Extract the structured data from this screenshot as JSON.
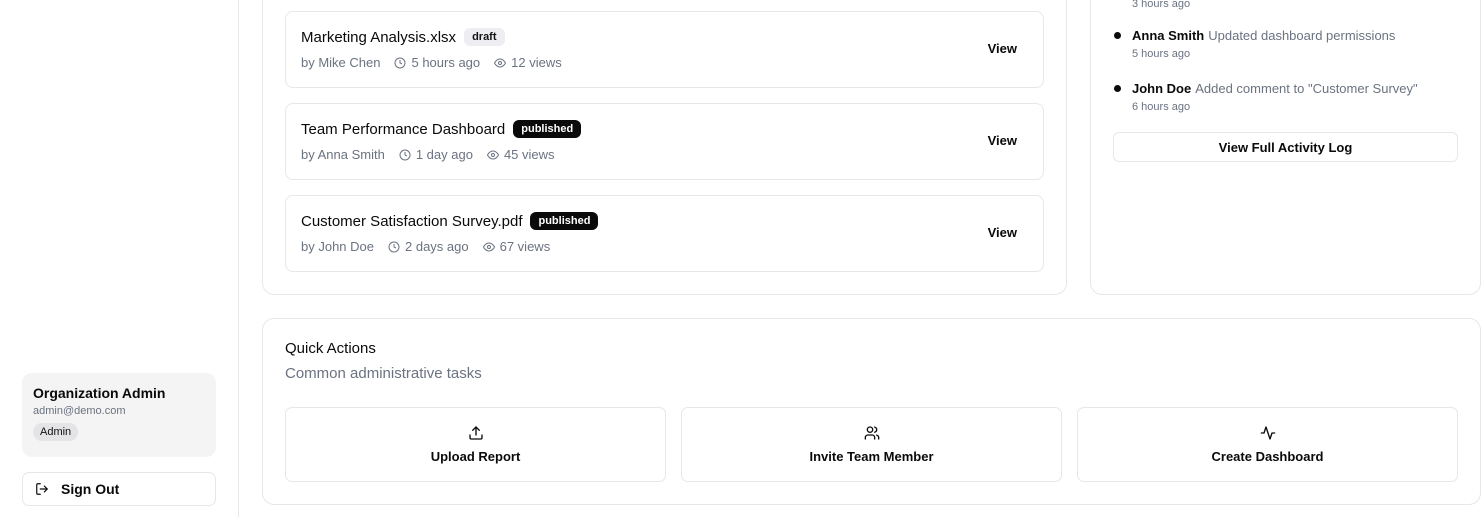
{
  "sidebar": {
    "user": {
      "name": "Organization Admin",
      "email": "admin@demo.com",
      "role": "Admin"
    },
    "sign_out_label": "Sign Out"
  },
  "reports": {
    "items": [
      {
        "title": "Marketing Analysis.xlsx",
        "status": "draft",
        "author": "by Mike Chen",
        "time": "5 hours ago",
        "views": "12 views",
        "view_label": "View"
      },
      {
        "title": "Team Performance Dashboard",
        "status": "published",
        "author": "by Anna Smith",
        "time": "1 day ago",
        "views": "45 views",
        "view_label": "View"
      },
      {
        "title": "Customer Satisfaction Survey.pdf",
        "status": "published",
        "author": "by John Doe",
        "time": "2 days ago",
        "views": "67 views",
        "view_label": "View"
      }
    ]
  },
  "activity": {
    "top_time": "3 hours ago",
    "entries": [
      {
        "user": "Anna Smith",
        "action": "Updated dashboard permissions",
        "time": "5 hours ago"
      },
      {
        "user": "John Doe",
        "action": "Added comment to \"Customer Survey\"",
        "time": "6 hours ago"
      }
    ],
    "full_log_label": "View Full Activity Log"
  },
  "quick_actions": {
    "title": "Quick Actions",
    "subtitle": "Common administrative tasks",
    "buttons": [
      {
        "label": "Upload Report",
        "icon": "upload-icon"
      },
      {
        "label": "Invite Team Member",
        "icon": "users-icon"
      },
      {
        "label": "Create Dashboard",
        "icon": "activity-icon"
      }
    ]
  },
  "colors": {
    "published_badge_bg": "#0a0a0a",
    "draft_badge_bg": "#eeeef2",
    "muted_text": "#6b7280",
    "border": "#e5e7eb"
  }
}
